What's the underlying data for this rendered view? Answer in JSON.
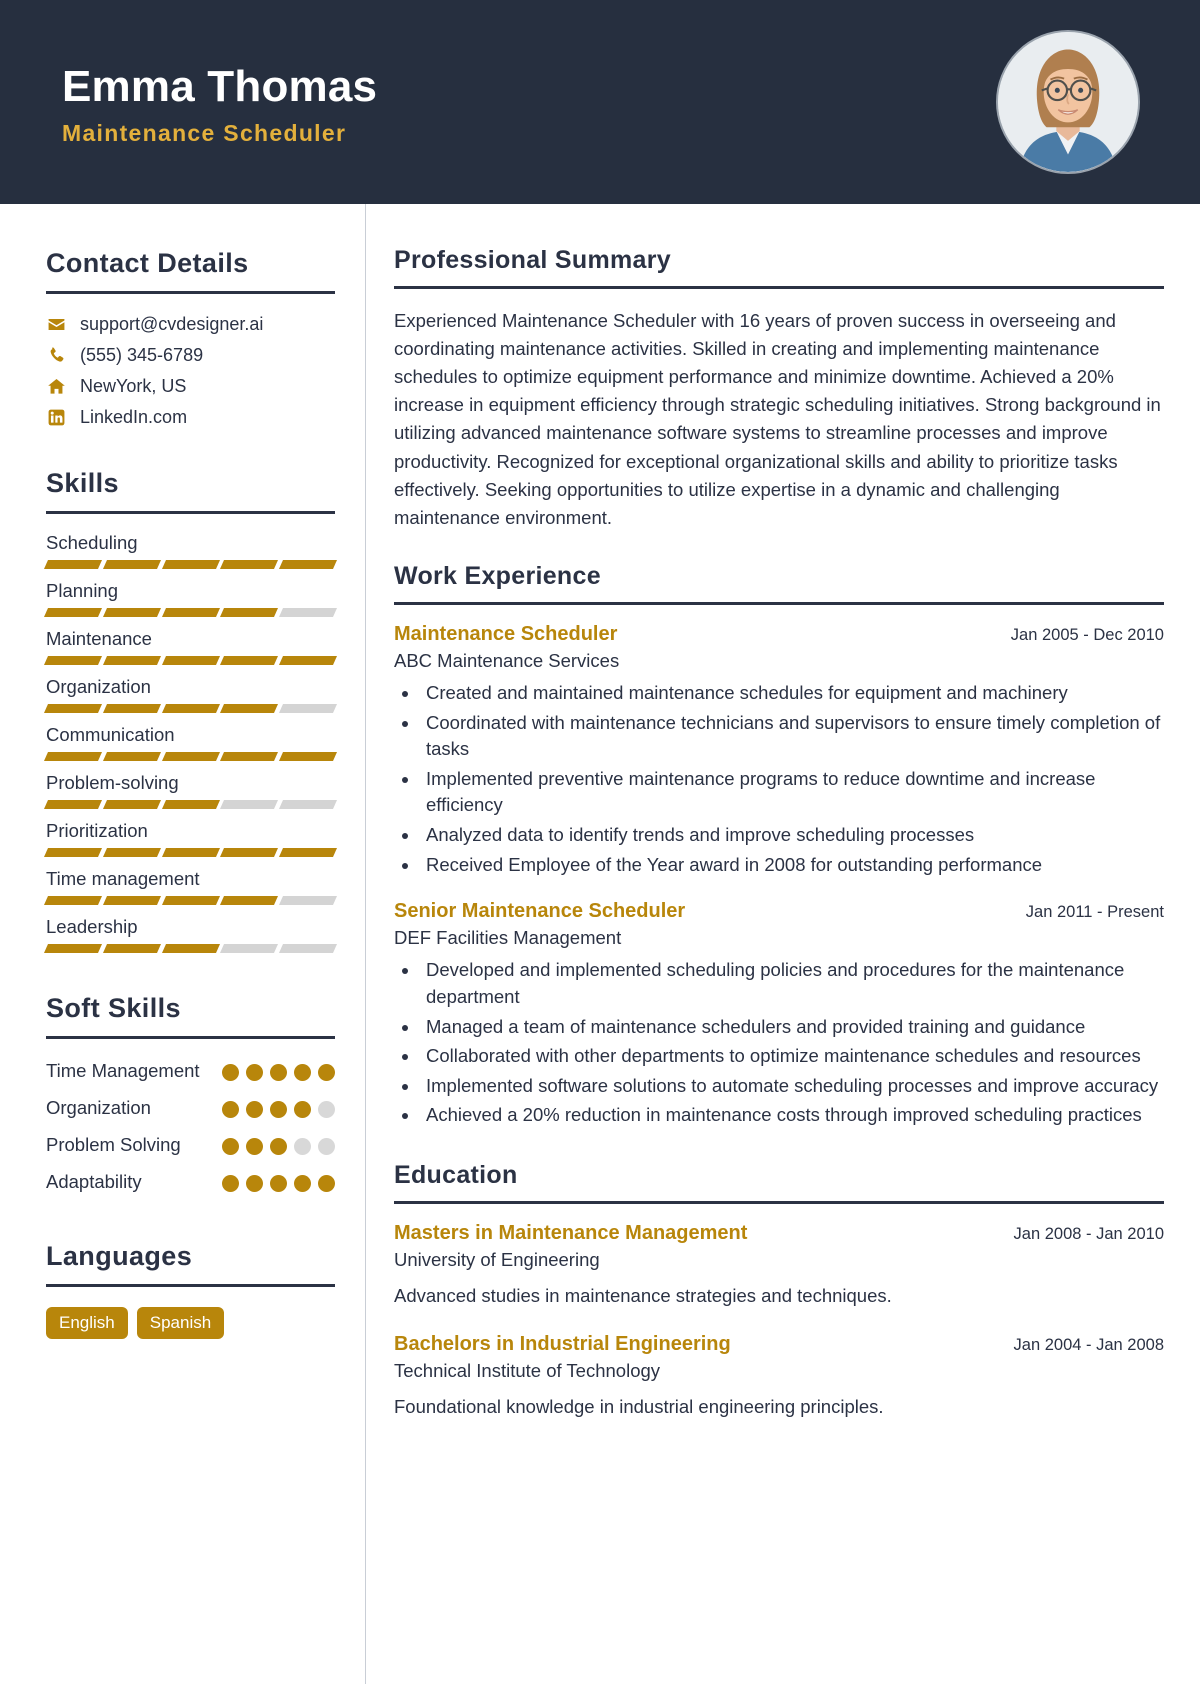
{
  "header": {
    "name": "Emma Thomas",
    "job_title": "Maintenance Scheduler",
    "avatar_alt": "profile-photo",
    "bg_color": "#262f3f",
    "accent_color": "#e3b03c"
  },
  "theme": {
    "gold": "#b8860b",
    "navy": "#2b3244",
    "track": "#d4d4d4"
  },
  "sidebar": {
    "contact": {
      "heading": "Contact Details",
      "items": [
        {
          "icon": "envelope-icon",
          "value": "support@cvdesigner.ai"
        },
        {
          "icon": "phone-icon",
          "value": "(555) 345-6789"
        },
        {
          "icon": "home-icon",
          "value": "NewYork, US"
        },
        {
          "icon": "linkedin-icon",
          "value": "LinkedIn.com"
        }
      ]
    },
    "skills": {
      "heading": "Skills",
      "max_level": 5,
      "items": [
        {
          "name": "Scheduling",
          "level": 5
        },
        {
          "name": "Planning",
          "level": 4
        },
        {
          "name": "Maintenance",
          "level": 5
        },
        {
          "name": "Organization",
          "level": 4
        },
        {
          "name": "Communication",
          "level": 5
        },
        {
          "name": "Problem-solving",
          "level": 3
        },
        {
          "name": "Prioritization",
          "level": 5
        },
        {
          "name": "Time management",
          "level": 4
        },
        {
          "name": "Leadership",
          "level": 3
        }
      ]
    },
    "soft_skills": {
      "heading": "Soft Skills",
      "max_level": 5,
      "items": [
        {
          "name": "Time Management",
          "level": 5
        },
        {
          "name": "Organization",
          "level": 4
        },
        {
          "name": "Problem Solving",
          "level": 3
        },
        {
          "name": "Adaptability",
          "level": 5
        }
      ]
    },
    "languages": {
      "heading": "Languages",
      "items": [
        "English",
        "Spanish"
      ]
    }
  },
  "main": {
    "summary": {
      "heading": "Professional Summary",
      "text": "Experienced Maintenance Scheduler with 16 years of proven success in overseeing and coordinating maintenance activities. Skilled in creating and implementing maintenance schedules to optimize equipment performance and minimize downtime. Achieved a 20% increase in equipment efficiency through strategic scheduling initiatives. Strong background in utilizing advanced maintenance software systems to streamline processes and improve productivity. Recognized for exceptional organizational skills and ability to prioritize tasks effectively. Seeking opportunities to utilize expertise in a dynamic and challenging maintenance environment."
    },
    "work_experience": {
      "heading": "Work Experience",
      "entries": [
        {
          "title": "Maintenance Scheduler",
          "date": "Jan 2005 - Dec 2010",
          "organization": "ABC Maintenance Services",
          "bullets": [
            "Created and maintained maintenance schedules for equipment and machinery",
            "Coordinated with maintenance technicians and supervisors to ensure timely completion of tasks",
            "Implemented preventive maintenance programs to reduce downtime and increase efficiency",
            "Analyzed data to identify trends and improve scheduling processes",
            "Received Employee of the Year award in 2008 for outstanding performance"
          ]
        },
        {
          "title": "Senior Maintenance Scheduler",
          "date": "Jan 2011 - Present",
          "organization": "DEF Facilities Management",
          "bullets": [
            "Developed and implemented scheduling policies and procedures for the maintenance department",
            "Managed a team of maintenance schedulers and provided training and guidance",
            "Collaborated with other departments to optimize maintenance schedules and resources",
            "Implemented software solutions to automate scheduling processes and improve accuracy",
            "Achieved a 20% reduction in maintenance costs through improved scheduling practices"
          ]
        }
      ]
    },
    "education": {
      "heading": "Education",
      "entries": [
        {
          "degree": "Masters in Maintenance Management",
          "date": "Jan 2008 - Jan 2010",
          "institution": "University of Engineering",
          "description": "Advanced studies in maintenance strategies and techniques."
        },
        {
          "degree": "Bachelors in Industrial Engineering",
          "date": "Jan 2004 - Jan 2008",
          "institution": "Technical Institute of Technology",
          "description": "Foundational knowledge in industrial engineering principles."
        }
      ]
    }
  }
}
